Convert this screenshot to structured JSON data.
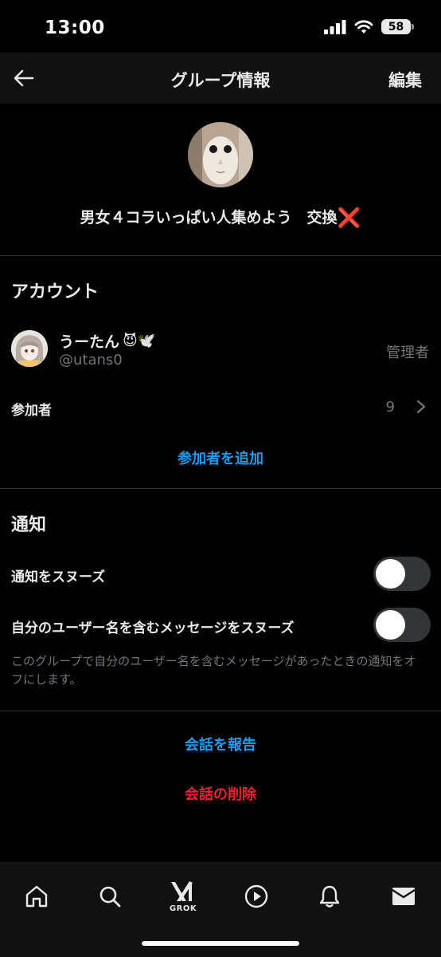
{
  "status_bar": {
    "time": "13:00",
    "battery": "58"
  },
  "header": {
    "title": "グループ情報",
    "edit_label": "編集"
  },
  "group": {
    "name": "男女４コラいっぱい人集めよう　交換",
    "name_suffix_icon": "❌"
  },
  "account_section": {
    "title": "アカウント",
    "member": {
      "name": "うーたん",
      "name_emojis": "😈🕊️",
      "handle": "@utans0",
      "role": "管理者"
    },
    "participants_label": "参加者",
    "participants_count": "9",
    "add_participants": "参加者を追加"
  },
  "notification_section": {
    "title": "通知",
    "snooze_label": "通知をスヌーズ",
    "snooze_on": false,
    "mention_snooze_label": "自分のユーザー名を含むメッセージをスヌーズ",
    "mention_snooze_on": false,
    "helper_text": "このグループで自分のユーザー名を含むメッセージがあったときの通知をオフにします。"
  },
  "actions": {
    "report": "会話を報告",
    "delete": "会話の削除"
  },
  "tabbar": {
    "icons": [
      "home-icon",
      "search-icon",
      "grok-icon",
      "play-icon",
      "bell-icon",
      "mail-icon"
    ],
    "grok_label": "GROK"
  },
  "colors": {
    "accent": "#1d9bf0",
    "danger": "#f4212e",
    "background": "#000000",
    "muted": "#71767b"
  }
}
